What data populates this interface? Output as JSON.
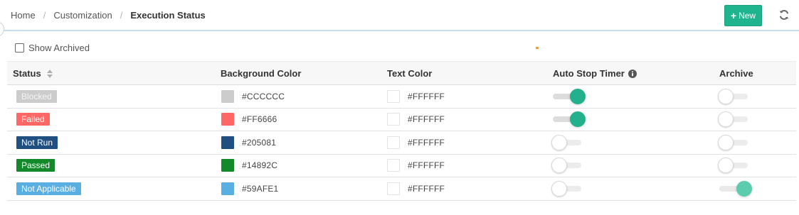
{
  "breadcrumb": {
    "items": [
      "Home",
      "Customization"
    ],
    "current": "Execution Status"
  },
  "toolbar": {
    "new_label": "New",
    "new_color": "#1fb38e",
    "refresh_icon": "refresh-icon"
  },
  "filter": {
    "show_archived_label": "Show Archived",
    "show_archived_checked": false
  },
  "table": {
    "columns": {
      "status": "Status",
      "background_color": "Background Color",
      "text_color": "Text Color",
      "auto_stop_timer": "Auto Stop Timer",
      "archive": "Archive"
    },
    "rows": [
      {
        "status": "Blocked",
        "background": "#CCCCCC",
        "text": "#FFFFFF",
        "auto_stop_timer": true,
        "archive": false
      },
      {
        "status": "Failed",
        "background": "#FF6666",
        "text": "#FFFFFF",
        "text_display": "#FFFFFF",
        "auto_stop_timer": true,
        "archive": false
      },
      {
        "status": "Not Run",
        "background": "#205081",
        "text": "#FFFFFF",
        "auto_stop_timer": false,
        "archive": false
      },
      {
        "status": "Passed",
        "background": "#14892C",
        "text": "#FFFFFF",
        "auto_stop_timer": false,
        "archive": false
      },
      {
        "status": "Not Applicable",
        "background": "#59AFE1",
        "text": "#FFFFFF",
        "auto_stop_timer": false,
        "archive": true
      }
    ]
  }
}
